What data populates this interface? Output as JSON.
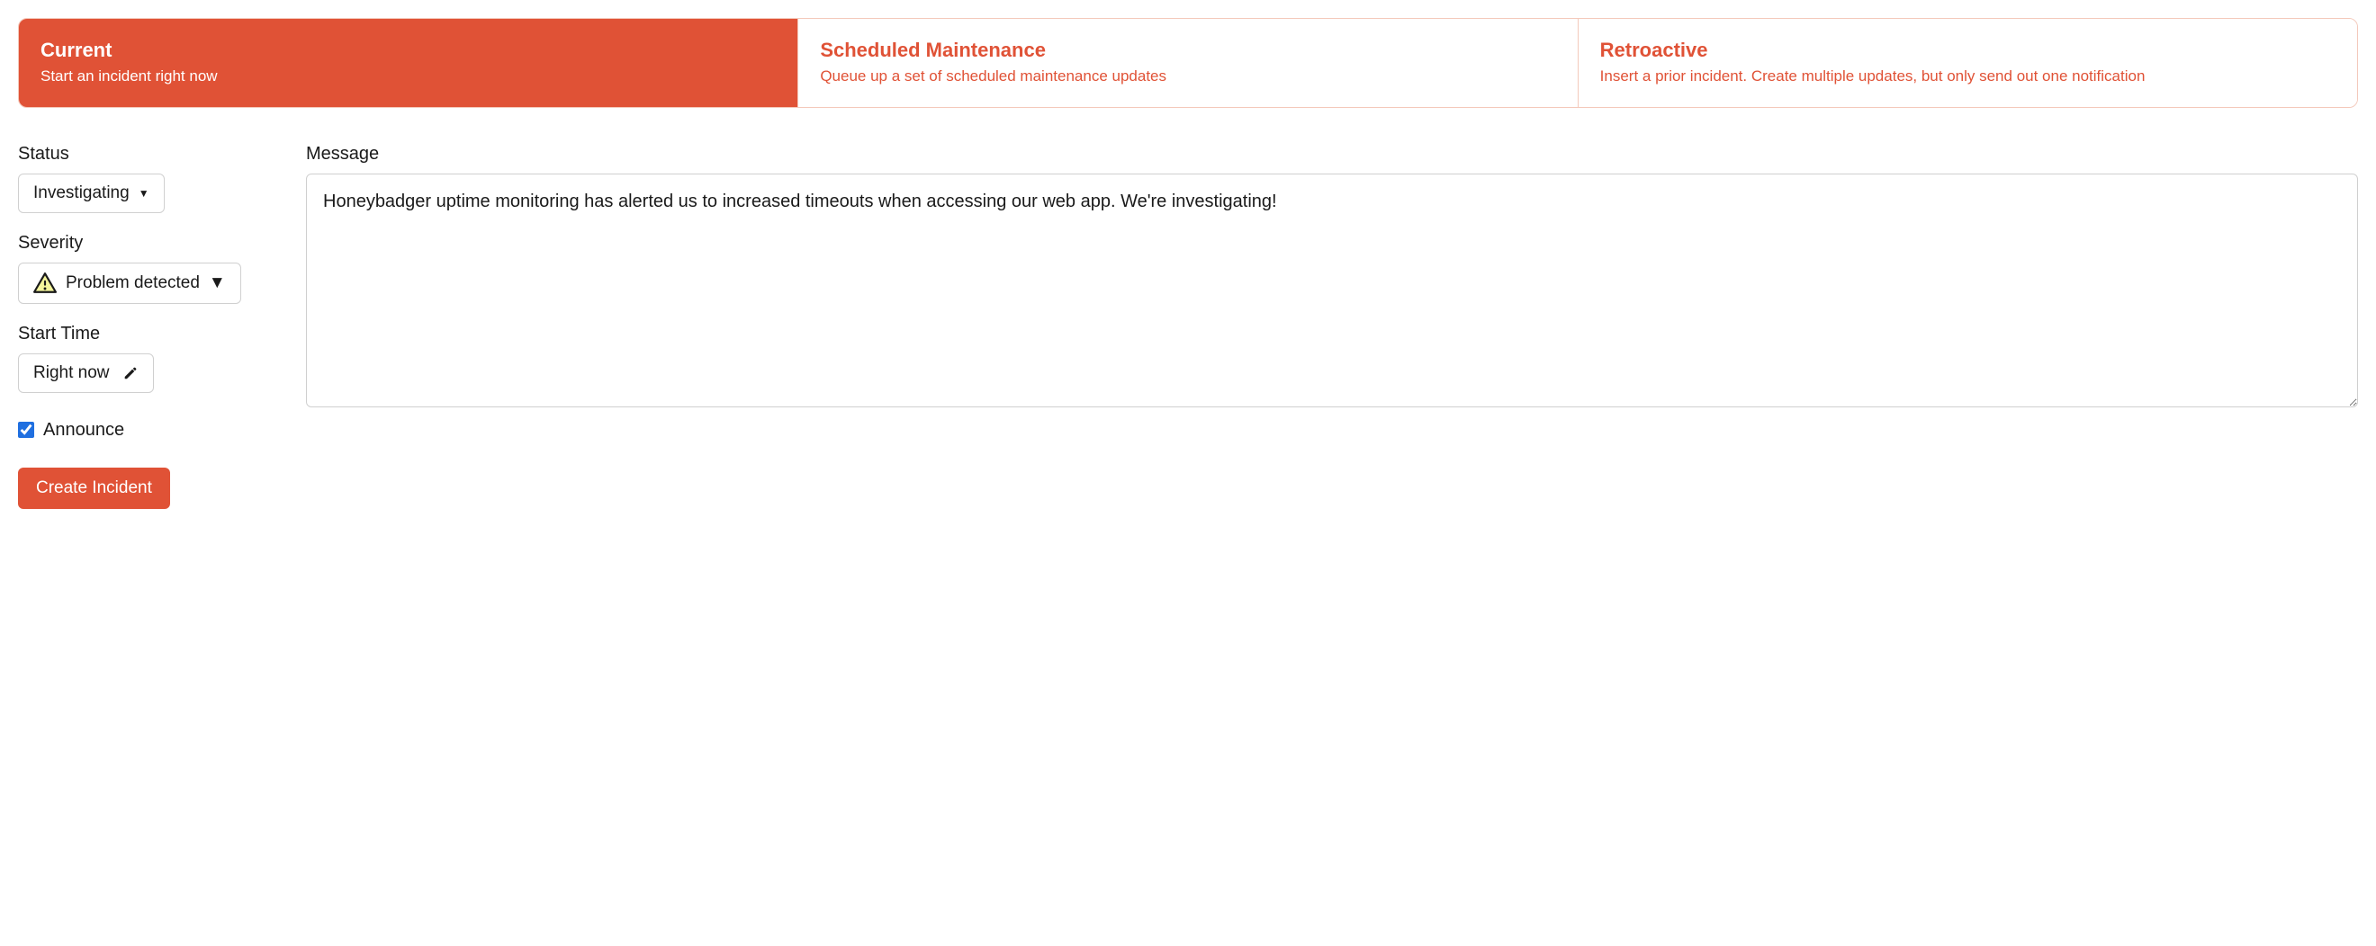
{
  "tabs": [
    {
      "title": "Current",
      "description": "Start an incident right now",
      "active": true
    },
    {
      "title": "Scheduled Maintenance",
      "description": "Queue up a set of scheduled maintenance updates",
      "active": false
    },
    {
      "title": "Retroactive",
      "description": "Insert a prior incident. Create multiple updates, but only send out one notification",
      "active": false
    }
  ],
  "form": {
    "status": {
      "label": "Status",
      "value": "Investigating"
    },
    "severity": {
      "label": "Severity",
      "value": "Problem detected"
    },
    "start_time": {
      "label": "Start Time",
      "value": "Right now"
    },
    "announce": {
      "label": "Announce",
      "checked": true
    },
    "message": {
      "label": "Message",
      "value": "Honeybadger uptime monitoring has alerted us to increased timeouts when accessing our web app. We're investigating!"
    },
    "submit_label": "Create Incident"
  }
}
